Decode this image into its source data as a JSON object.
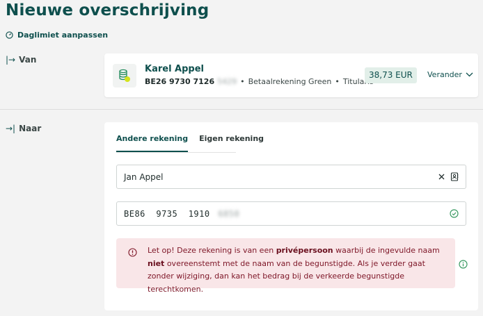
{
  "page": {
    "title": "Nieuwe overschrijving",
    "limit_link": "Daglimiet aanpassen"
  },
  "van": {
    "label": "Van",
    "holder": "Karel Appel",
    "iban": "BE26 9730 7126",
    "iban_masked": "5429",
    "account_type": "Betaalrekening Green",
    "role": "Titularis",
    "separator": "•",
    "balance": "38,73 EUR",
    "change_label": "Verander"
  },
  "naar": {
    "label": "Naar",
    "tabs": [
      {
        "label": "Andere rekening",
        "active": true
      },
      {
        "label": "Eigen rekening",
        "active": false
      }
    ],
    "name_value": "Jan Appel",
    "iban_value": "BE86  9735  1910",
    "iban_masked": "6850",
    "alert": {
      "part1": "Let op! Deze rekening is van een ",
      "bold1": "privépersoon",
      "part2": " waarbij de ingevulde naam ",
      "bold2": "niet",
      "part3": " overeenstemt met de naam van de begunstigde. Als je verder gaat zonder wijziging, dan kan het bedrag bij de verkeerde begunstigde terechtkomen."
    }
  },
  "colors": {
    "brand": "#0e4f4d",
    "balance_bg": "#e2efe9",
    "alert_bg": "#f9e6e8",
    "alert_text": "#7d1526",
    "success": "#3a9a62"
  },
  "icons": {
    "limit": "speedometer-icon",
    "van_arrow": "arrow-right-bar-icon",
    "naar_arrow": "arrow-right-bar-icon",
    "account": "coins-stack-icon",
    "change": "chevron-down-icon",
    "clear": "close-icon",
    "contacts": "contact-book-icon",
    "valid": "check-circle-icon",
    "warning": "info-circle-icon",
    "info": "info-circle-icon"
  }
}
